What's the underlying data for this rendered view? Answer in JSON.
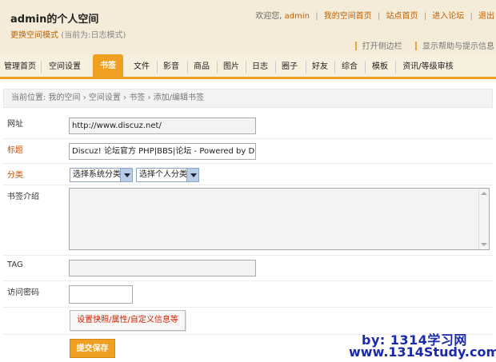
{
  "header": {
    "space_title": "admin的个人空间",
    "mode_link": "更换空间模式",
    "mode_current": "(当前为:日志模式)",
    "welcome": "欢迎您,",
    "username": "admin",
    "nav": [
      "我的空间首页",
      "站点首页",
      "进入论坛",
      "退出"
    ],
    "separator": "|",
    "side_links": [
      "打开侧边栏",
      "显示帮助与提示信息"
    ]
  },
  "tabs": [
    {
      "label": "管理首页",
      "active": false
    },
    {
      "label": "空间设置",
      "active": false
    },
    {
      "label": "书签",
      "active": true
    },
    {
      "label": "文件",
      "active": false
    },
    {
      "label": "影音",
      "active": false
    },
    {
      "label": "商品",
      "active": false
    },
    {
      "label": "图片",
      "active": false
    },
    {
      "label": "日志",
      "active": false
    },
    {
      "label": "圈子",
      "active": false
    },
    {
      "label": "好友",
      "active": false
    },
    {
      "label": "综合",
      "active": false
    },
    {
      "label": "模板",
      "active": false
    },
    {
      "label": "资讯/等级审核",
      "active": false
    }
  ],
  "breadcrumb": "当前位置: 我的空间 › 空间设置 › 书签 › 添加/编辑书签",
  "form": {
    "url_label": "网址",
    "url_value": "http://www.discuz.net/",
    "title_label": "标题",
    "title_value": "Discuz! 论坛官方  PHP|BBS|论坛  - Powered by Disc",
    "category_label": "分类",
    "system_category": "选择系统分类",
    "personal_category": "选择个人分类",
    "description_label": "书签介绍",
    "description_value": "",
    "tag_label": "TAG",
    "tag_value": "",
    "password_label": "访问密码",
    "password_value": ""
  },
  "buttons": {
    "settings": "设置快照/属性/自定义信息等",
    "submit": "提交保存"
  },
  "watermark": {
    "line1": "by: 1314学习网",
    "line2": "www.1314Study.com"
  },
  "colors": {
    "accent": "#f0a020",
    "header_bg": "#f4ecd8",
    "link": "#c06000",
    "watermark": "#1a2aa8"
  }
}
